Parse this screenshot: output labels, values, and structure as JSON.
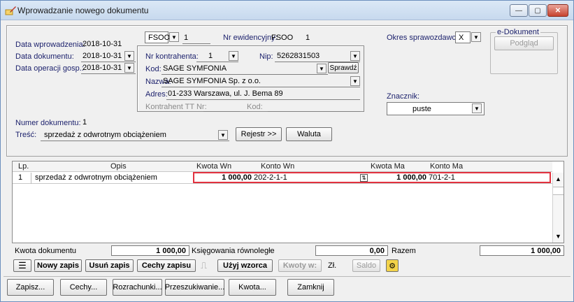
{
  "window": {
    "title": "Wprowadzanie nowego dokumentu"
  },
  "header": {
    "data_wprowadzenia_label": "Data wprowadzenia:",
    "data_wprowadzenia_value": "2018-10-31",
    "data_dokumentu_label": "Data dokumentu:",
    "data_dokumentu_value": "2018-10-31",
    "data_operacji_label": "Data operacji gosp.:",
    "data_operacji_value": "2018-10-31",
    "doc_type": "FSOO",
    "doc_number": "1",
    "nr_ewid_label": "Nr ewidencyjny:",
    "nr_ewid_value": "FSOO",
    "nr_ewid_num": "1",
    "okres_label": "Okres sprawozdawczy:",
    "okres_value": "X",
    "edok_label": "e-Dokument",
    "podglad_label": "Podgląd"
  },
  "contractor": {
    "nr_label": "Nr kontrahenta:",
    "nr_value": "1",
    "nip_label": "Nip:",
    "nip_value": "5262831503",
    "kod_label": "Kod:",
    "kod_value": "SAGE SYMFONIA",
    "sprawdz_label": "Sprawdź",
    "nazwa_label": "Nazwa:",
    "nazwa_value": "SAGE SYMFONIA Sp. z o.o.",
    "adres_label": "Adres:",
    "adres_value": "01-233 Warszawa, ul. J. Bema 89",
    "tt_label": "Kontrahent TT Nr:",
    "kod2_label": "Kod:"
  },
  "znacznik": {
    "label": "Znacznik:",
    "value": "puste"
  },
  "document": {
    "numer_label": "Numer dokumentu:",
    "numer_value": "1",
    "tresc_label": "Treść:",
    "tresc_value": "sprzedaż z odwrotnym obciążeniem",
    "rejestr_label": "Rejestr >>",
    "waluta_label": "Waluta"
  },
  "grid": {
    "headers": [
      "Lp.",
      "Opis",
      "Kwota Wn",
      "Konto Wn",
      "Kwota Ma",
      "Konto Ma"
    ],
    "rows": [
      {
        "lp": "1",
        "opis": "sprzedaż z odwrotnym obciążeniem",
        "kwota_wn": "1 000,00",
        "konto_wn": "202-2-1-1",
        "kwota_ma": "1 000,00",
        "konto_ma": "701-2-1"
      }
    ]
  },
  "totals": {
    "kwota_dok_label": "Kwota dokumentu",
    "kwota_dok_value": "1 000,00",
    "ksieg_label": "Księgowania równoległe",
    "ksieg_value": "0,00",
    "razem_label": "Razem",
    "razem_value": "1 000,00"
  },
  "toolbar": {
    "nowy_zapis": "Nowy zapis",
    "usun_zapis": "Usuń zapis",
    "cechy_zapisu": "Cechy zapisu",
    "uzyj_wzorca": "Użyj wzorca",
    "kwoty_w": "Kwoty w:",
    "zl": "Zł.",
    "saldo": "Saldo"
  },
  "footer": {
    "zapisz": "Zapisz...",
    "cechy": "Cechy...",
    "rozrachunki": "Rozrachunki...",
    "przeszukiwanie": "Przeszukiwanie...",
    "kwota": "Kwota...",
    "zamknij": "Zamknij"
  },
  "colors": {
    "highlight": "#e2323f",
    "label": "#1a1f6b"
  }
}
